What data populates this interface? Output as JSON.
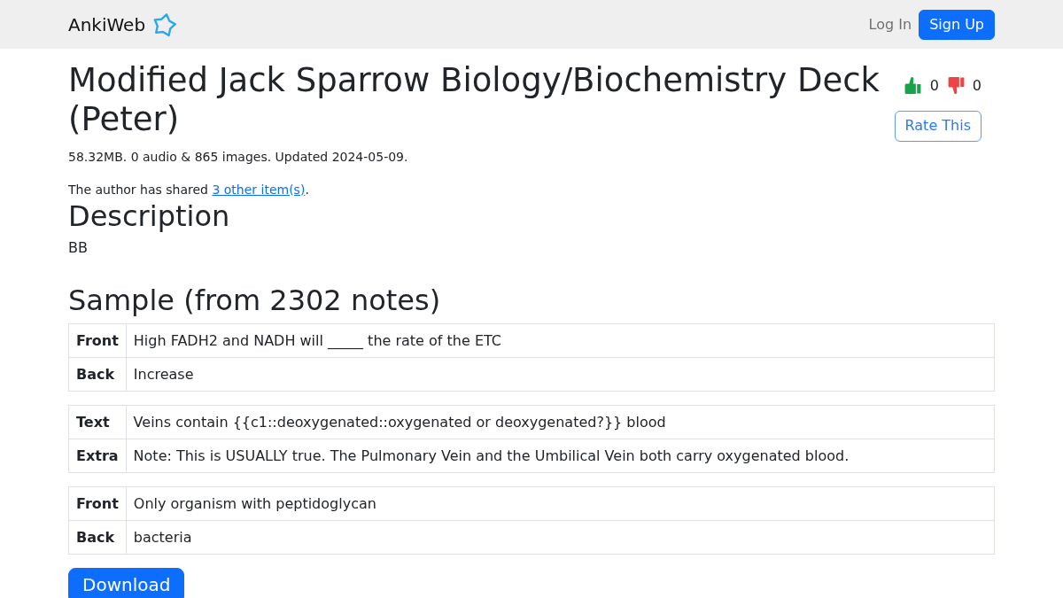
{
  "navbar": {
    "brand": "AnkiWeb",
    "links": [
      {
        "label": "Log In",
        "kind": "link"
      },
      {
        "label": "Sign Up",
        "kind": "button"
      }
    ]
  },
  "deck": {
    "title": "Modified Jack Sparrow Biology/Biochemistry Deck (Peter)",
    "rating": {
      "thumbs_up": "0",
      "thumbs_down": "0"
    },
    "rate_button": "Rate This",
    "meta": "58.32MB. 0 audio & 865 images. Updated 2024-05-09.",
    "shared": {
      "before": "The author has shared ",
      "link": "3 other item(s)",
      "after": "."
    }
  },
  "description": {
    "heading": "Description",
    "body": "BB"
  },
  "sample": {
    "heading": "Sample (from 2302 notes)",
    "notes": [
      {
        "fields": [
          {
            "name": "Front",
            "value": "High FADH2 and NADH will _____ the rate of the ETC"
          },
          {
            "name": "Back",
            "value": "Increase"
          }
        ]
      },
      {
        "fields": [
          {
            "name": "Text",
            "value": "Veins contain {{c1::deoxygenated::oxygenated or deoxygenated?}} blood"
          },
          {
            "name": "Extra",
            "value": "Note: This is USUALLY true. The Pulmonary Vein and the Umbilical Vein both carry oxygenated blood."
          }
        ]
      },
      {
        "fields": [
          {
            "name": "Front",
            "value": "Only organism with peptidoglycan"
          },
          {
            "name": "Back",
            "value": "bacteria"
          }
        ]
      }
    ]
  },
  "download_button": "Download"
}
